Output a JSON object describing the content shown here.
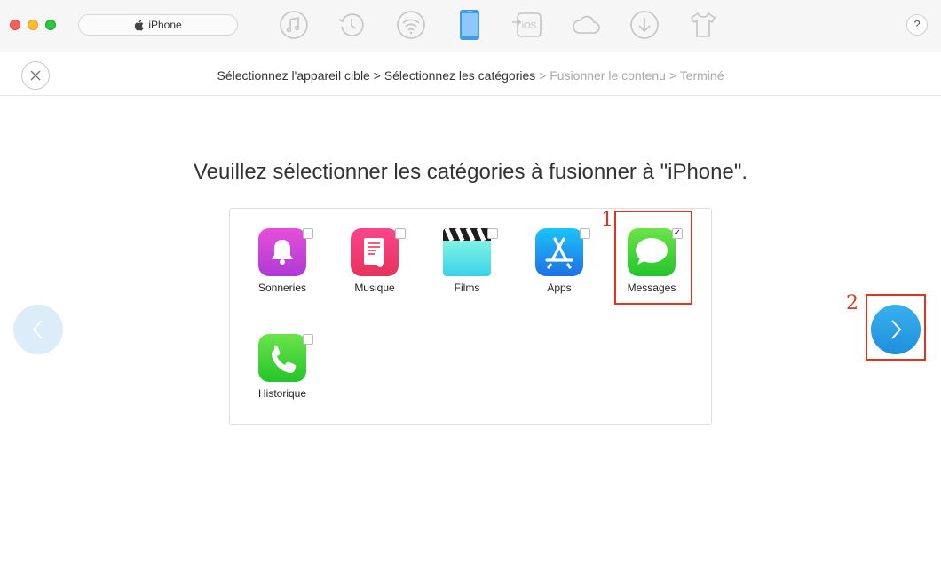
{
  "window": {
    "device_label": "iPhone",
    "help_label": "?"
  },
  "toolbar": {
    "items": [
      {
        "name": "music-icon"
      },
      {
        "name": "history-icon"
      },
      {
        "name": "wifi-icon"
      },
      {
        "name": "device-icon",
        "active": true
      },
      {
        "name": "ios-icon",
        "text": "iOS"
      },
      {
        "name": "cloud-icon"
      },
      {
        "name": "download-icon"
      },
      {
        "name": "shirt-icon"
      }
    ],
    "accent": "#3d9be9"
  },
  "breadcrumb": {
    "step1": "Sélectionnez l'appareil cible",
    "sep1": " > ",
    "step2": "Sélectionnez les catégories",
    "sep2": " > ",
    "step3": "Fusionner le contenu",
    "sep3": " > ",
    "step4": "Terminé"
  },
  "main": {
    "heading": "Veuillez sélectionner les catégories à fusionner à \"iPhone\"."
  },
  "categories": [
    {
      "label": "Sonneries",
      "icon": "bell-icon",
      "checked": false
    },
    {
      "label": "Musique",
      "icon": "music-note-icon",
      "checked": false
    },
    {
      "label": "Films",
      "icon": "clapper-icon",
      "checked": false
    },
    {
      "label": "Apps",
      "icon": "app-store-icon",
      "checked": false
    },
    {
      "label": "Messages",
      "icon": "messages-icon",
      "checked": true,
      "check_mark": "✓"
    },
    {
      "label": "Historique",
      "icon": "phone-icon",
      "checked": false
    }
  ],
  "annotations": {
    "step1": "1",
    "step2": "2",
    "color": "#e2331e"
  }
}
